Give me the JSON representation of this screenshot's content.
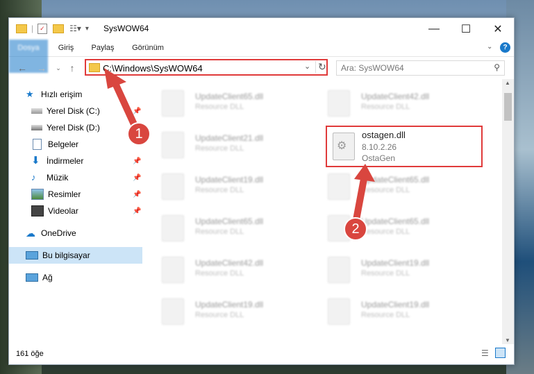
{
  "window": {
    "title": "SysWOW64"
  },
  "ribbon": {
    "tabs": [
      "Dosya",
      "Giriş",
      "Paylaş",
      "Görünüm"
    ]
  },
  "address": {
    "path": "C:\\Windows\\SysWOW64"
  },
  "search": {
    "placeholder": "Ara: SysWOW64"
  },
  "sidebar": {
    "items": [
      {
        "label": "Hızlı erişim"
      },
      {
        "label": "Yerel Disk (C:)"
      },
      {
        "label": "Yerel Disk (D:)"
      },
      {
        "label": "Belgeler"
      },
      {
        "label": "İndirmeler"
      },
      {
        "label": "Müzik"
      },
      {
        "label": "Resimler"
      },
      {
        "label": "Videolar"
      },
      {
        "label": "OneDrive"
      },
      {
        "label": "Bu bilgisayar"
      },
      {
        "label": "Ağ"
      }
    ]
  },
  "files": {
    "left": [
      {
        "name": "UpdateClient65.dll",
        "type": "Resource DLL"
      },
      {
        "name": "UpdateClient21.dll",
        "type": "Resource DLL"
      },
      {
        "name": "UpdateClient19.dll",
        "type": "Resource DLL"
      },
      {
        "name": "UpdateClient65.dll",
        "type": "Resource DLL"
      },
      {
        "name": "UpdateClient42.dll",
        "type": "Resource DLL"
      },
      {
        "name": "UpdateClient19.dll",
        "type": "Resource DLL"
      }
    ],
    "right": [
      {
        "name": "UpdateClient42.dll",
        "type": "Resource DLL"
      },
      {
        "name": "UpdateClient65.dll",
        "type": "Resource DLL"
      },
      {
        "name": "UpdateClient65.dll",
        "type": "Resource DLL"
      },
      {
        "name": "UpdateClient19.dll",
        "type": "Resource DLL"
      },
      {
        "name": "UpdateClient19.dll",
        "type": "Resource DLL"
      }
    ],
    "highlighted": {
      "name": "ostagen.dll",
      "version": "8.10.2.26",
      "company": "OstaGen"
    }
  },
  "status": {
    "count": "161 öğe"
  },
  "badges": {
    "one": "1",
    "two": "2"
  },
  "colors": {
    "accent": "#1979ca",
    "highlight": "#e03a3a"
  }
}
